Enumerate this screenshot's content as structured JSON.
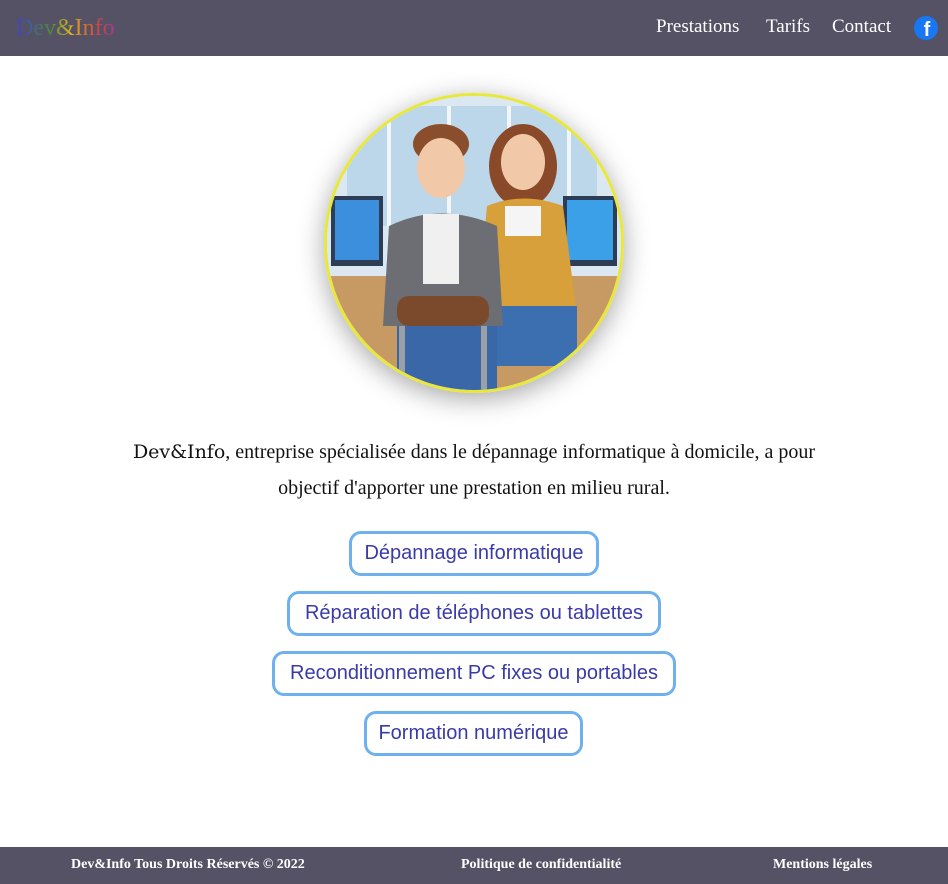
{
  "header": {
    "logo": "Dev&Info",
    "nav": [
      {
        "label": "Prestations"
      },
      {
        "label": "Tarifs"
      },
      {
        "label": "Contact"
      }
    ],
    "social_icon": "facebook-icon",
    "social_color": "#1877f2"
  },
  "hero": {
    "image": "illustration of two technicians at computer desks",
    "border_color": "#e8e83a"
  },
  "intro": {
    "brand": "Dev&Info",
    "text": ", entreprise spécialisée dans le dépannage informatique à domicile, a pour objectif d'apporter une prestation en milieu rural."
  },
  "services": [
    {
      "label": "Dépannage informatique"
    },
    {
      "label": "Réparation de téléphones ou tablettes"
    },
    {
      "label": "Reconditionnement PC fixes ou portables"
    },
    {
      "label": "Formation numérique"
    }
  ],
  "footer": {
    "copyright": "Dev&Info Tous Droits Réservés © 2022",
    "privacy": "Politique de confidentialité",
    "legal": "Mentions légales"
  },
  "colors": {
    "bar": "#555266",
    "button_border": "#6fb0ee",
    "button_text": "#3a3aa8"
  }
}
